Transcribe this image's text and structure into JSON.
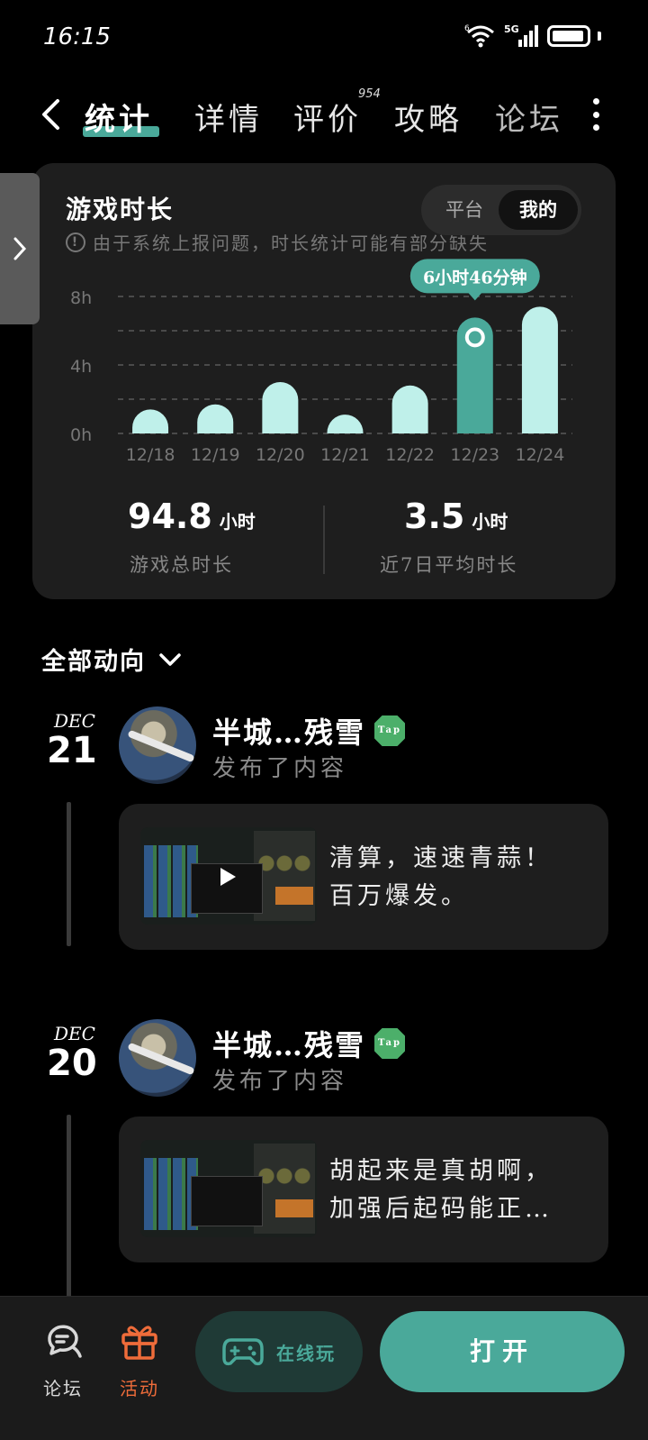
{
  "status": {
    "time": "16:15",
    "network": "5G",
    "wifi_sub": "6"
  },
  "tabs": [
    {
      "label": "统计",
      "active": true
    },
    {
      "label": "详情",
      "active": false
    },
    {
      "label": "评价",
      "badge": "954",
      "active": false
    },
    {
      "label": "攻略",
      "active": false
    },
    {
      "label": "论坛",
      "active": false
    }
  ],
  "stats": {
    "title": "游戏时长",
    "note": "由于系统上报问题，时长统计可能有部分缺失",
    "toggle": {
      "options": [
        "平台",
        "我的"
      ],
      "selected": "我的"
    },
    "total_value": "94.8",
    "total_unit": "小时",
    "total_label": "游戏总时长",
    "avg_value": "3.5",
    "avg_unit": "小时",
    "avg_label": "近7日平均时长"
  },
  "chart_data": {
    "type": "bar",
    "categories": [
      "12/18",
      "12/19",
      "12/20",
      "12/21",
      "12/22",
      "12/23",
      "12/24"
    ],
    "values": [
      1.4,
      1.7,
      3.0,
      1.1,
      2.8,
      6.77,
      7.4
    ],
    "y_ticks": [
      "0h",
      "4h",
      "8h"
    ],
    "ylim": [
      0,
      8
    ],
    "highlight_index": 5,
    "highlight_label": "6小时46分钟",
    "bar_color": "#bff0ea",
    "highlight_color": "#4aa99a",
    "grid": true
  },
  "feed": {
    "header": "全部动向",
    "entries": [
      {
        "month": "DEC",
        "day": "21",
        "user": "半城…残雪",
        "badge": "Tap",
        "action": "发布了内容",
        "text": "清算，速速青蒜！\n百万爆发。",
        "has_video": true
      },
      {
        "month": "DEC",
        "day": "20",
        "user": "半城…残雪",
        "badge": "Tap",
        "action": "发布了内容",
        "text": "胡起来是真胡啊，\n加强后起码能正…",
        "has_video": false
      }
    ]
  },
  "bottom": {
    "forum_label": "论坛",
    "activity_label": "活动",
    "play_online_label": "在线玩",
    "open_label": "打开",
    "accent": "#4aa99a",
    "activity_color": "#ef6c3a"
  }
}
